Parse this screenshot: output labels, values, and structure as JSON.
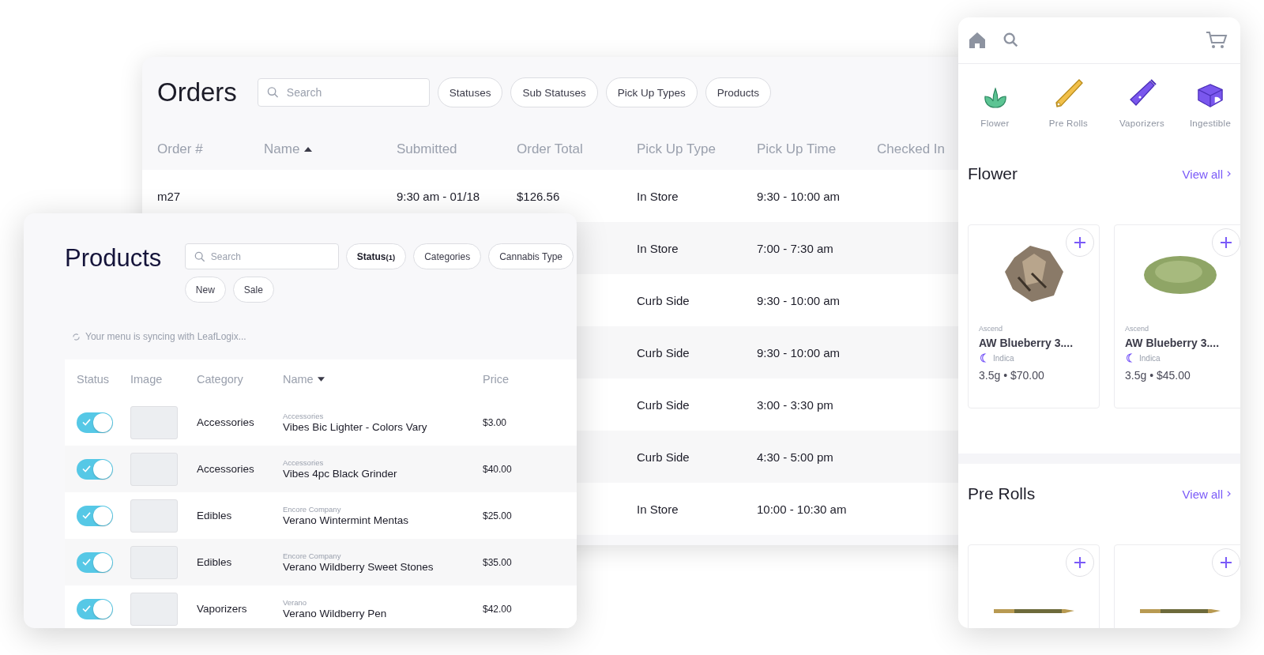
{
  "orders": {
    "title": "Orders",
    "search": {
      "placeholder": "Search"
    },
    "filters": [
      "Statuses",
      "Sub Statuses",
      "Pick Up Types",
      "Products"
    ],
    "columns": [
      {
        "label": "Order #"
      },
      {
        "label": "Name",
        "sorted": true,
        "ascending": true
      },
      {
        "label": "Submitted"
      },
      {
        "label": "Order Total"
      },
      {
        "label": "Pick Up Type"
      },
      {
        "label": "Pick Up Time"
      },
      {
        "label": "Checked In"
      }
    ],
    "rows": [
      {
        "cells": [
          "m27",
          null,
          "9:30 am - 01/18",
          "$126.56",
          "In Store",
          "9:30 - 10:00 am"
        ]
      },
      {
        "cells": [
          null,
          null,
          null,
          null,
          "In Store",
          "7:00 - 7:30 am"
        ]
      },
      {
        "cells": [
          null,
          null,
          null,
          null,
          "Curb Side",
          "9:30 - 10:00 am"
        ]
      },
      {
        "cells": [
          null,
          null,
          null,
          null,
          "Curb Side",
          "9:30 - 10:00 am"
        ]
      },
      {
        "cells": [
          null,
          null,
          null,
          null,
          "Curb Side",
          "3:00 - 3:30 pm"
        ]
      },
      {
        "cells": [
          null,
          null,
          null,
          null,
          "Curb Side",
          "4:30 - 5:00 pm"
        ]
      },
      {
        "cells": [
          null,
          null,
          null,
          null,
          "In Store",
          "10:00 - 10:30 am"
        ]
      }
    ]
  },
  "products": {
    "title": "Products",
    "search": {
      "placeholder": "Search"
    },
    "filters": [
      {
        "label": "Status",
        "count": "(1)",
        "active": true
      },
      {
        "label": "Categories",
        "active": false
      },
      {
        "label": "Cannabis Type",
        "active": false
      },
      {
        "label": "New",
        "active": false
      },
      {
        "label": "Sale",
        "active": false
      }
    ],
    "sync_message": "Your menu is syncing with LeafLogix...",
    "columns": [
      {
        "label": "Status"
      },
      {
        "label": "Image"
      },
      {
        "label": "Category"
      },
      {
        "label": "Name",
        "sorted": true,
        "ascending": false
      },
      {
        "label": "Price"
      }
    ],
    "rows": [
      {
        "on": true,
        "category": "Accessories",
        "brand": "Accessories",
        "name": "Vibes Bic Lighter - Colors Vary",
        "price": "$3.00"
      },
      {
        "on": true,
        "category": "Accessories",
        "brand": "Accessories",
        "name": "Vibes 4pc Black Grinder",
        "price": "$40.00"
      },
      {
        "on": true,
        "category": "Edibles",
        "brand": "Encore Company",
        "name": "Verano Wintermint Mentas",
        "price": "$25.00"
      },
      {
        "on": true,
        "category": "Edibles",
        "brand": "Encore Company",
        "name": "Verano Wildberry Sweet Stones",
        "price": "$35.00"
      },
      {
        "on": true,
        "category": "Vaporizers",
        "brand": "Verano",
        "name": "Verano Wildberry Pen",
        "price": "$42.00"
      }
    ]
  },
  "menu": {
    "categories": [
      {
        "label": "Flower",
        "kind": "flower"
      },
      {
        "label": "Pre Rolls",
        "kind": "preroll"
      },
      {
        "label": "Vaporizers",
        "kind": "vape"
      },
      {
        "label": "Ingestible",
        "kind": "ingestible"
      }
    ],
    "sections": [
      {
        "title": "Flower",
        "link": "View all",
        "products": [
          {
            "kind": "bud",
            "brand": "Ascend",
            "name": "AW Blueberry 3....",
            "strain": "Indica",
            "size_price": "3.5g • $70.00"
          },
          {
            "kind": "ground",
            "brand": "Ascend",
            "name": "AW Blueberry 3....",
            "strain": "Indica",
            "size_price": "3.5g • $45.00"
          }
        ]
      },
      {
        "title": "Pre Rolls",
        "link": "View all",
        "products": [
          {
            "kind": "preroll"
          },
          {
            "kind": "preroll"
          }
        ]
      }
    ]
  }
}
